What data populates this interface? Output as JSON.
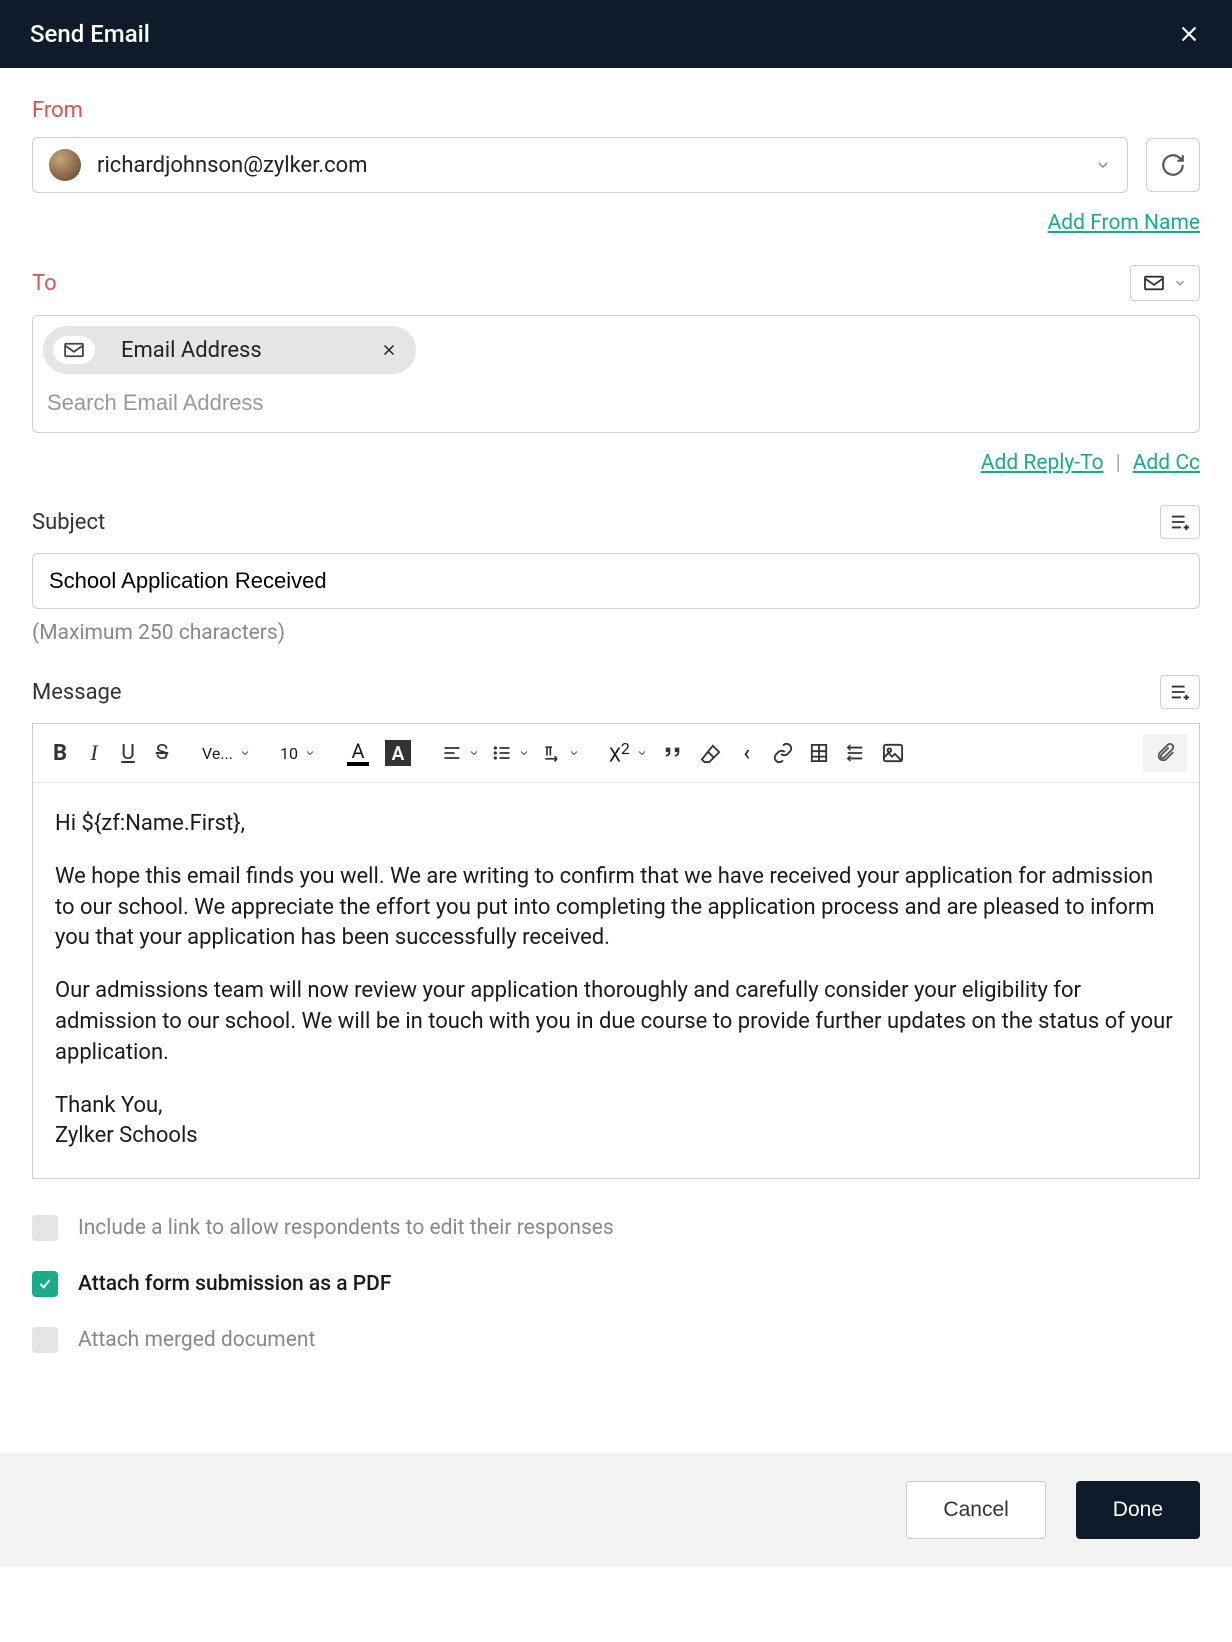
{
  "header": {
    "title": "Send Email"
  },
  "from": {
    "label": "From",
    "email": "richardjohnson@zylker.com",
    "add_name_link": "Add From Name"
  },
  "to": {
    "label": "To",
    "chip_text": "Email Address",
    "search_placeholder": "Search Email Address",
    "reply_to_link": "Add Reply-To",
    "cc_link": "Add Cc"
  },
  "subject": {
    "label": "Subject",
    "value": "School Application Received",
    "help": "(Maximum 250 characters)"
  },
  "message": {
    "label": "Message",
    "font_family": "Ve...",
    "font_size": "10",
    "body_greeting": "Hi ${zf:Name.First},",
    "body_p1": "We hope this email finds you well. We are writing to confirm that we have received your application for admission to our school. We appreciate the effort you put into completing the application process and are pleased to inform you that your application has been successfully received.",
    "body_p2": "Our admissions team will now review your application thoroughly and carefully consider your eligibility for admission to our school. We will be in touch with you in due course to provide further updates on the status of your application.",
    "body_thanks": "Thank You,",
    "body_signature": "Zylker Schools"
  },
  "options": {
    "edit_link": "Include a link to allow respondents to edit their responses",
    "attach_pdf": "Attach form submission as a PDF",
    "attach_merged": "Attach merged document"
  },
  "footer": {
    "cancel": "Cancel",
    "done": "Done"
  }
}
